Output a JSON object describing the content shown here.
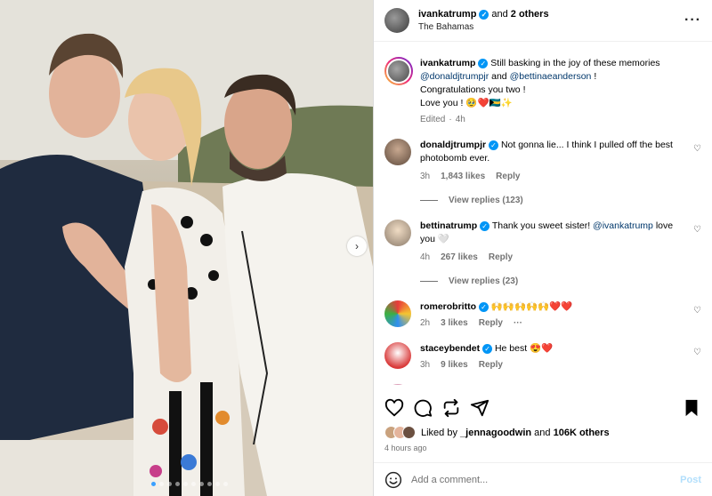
{
  "post": {
    "author": "ivankatrump",
    "collab_and": "and",
    "collab_others": "2 others",
    "location": "The Bahamas",
    "slide_count": 10,
    "active_slide": 1
  },
  "caption": {
    "username": "ivankatrump",
    "text1": "Still basking in the joy of these memories",
    "mention1": "@donaldjtrumpjr",
    "and": "and",
    "mention2": "@bettinaeanderson",
    "text2": "!",
    "line2": "Congratulations you two !",
    "line3": "Love you ! 🥹❤️🇧🇸✨",
    "edited": "Edited",
    "time": "4h"
  },
  "comments": [
    {
      "username": "donaldjtrumpjr",
      "verified": true,
      "text": "Not gonna lie... I think I pulled off the best photobomb ever.",
      "time": "3h",
      "likes": "1,843 likes",
      "reply": "Reply",
      "view_replies": "View replies (123)"
    },
    {
      "username": "bettinatrump",
      "verified": true,
      "text_pre": "Thank you sweet sister!",
      "mention": "@ivankatrump",
      "text_post": "love you 🤍",
      "time": "4h",
      "likes": "267 likes",
      "reply": "Reply",
      "view_replies": "View replies (23)"
    },
    {
      "username": "romerobritto",
      "verified": true,
      "text": "🙌🙌🙌🙌🙌❤️❤️",
      "time": "2h",
      "likes": "3 likes",
      "reply": "Reply",
      "more": "···"
    },
    {
      "username": "staceybendet",
      "verified": true,
      "text": "He best 😍❤️",
      "time": "3h",
      "likes": "9 likes",
      "reply": "Reply"
    }
  ],
  "likes": {
    "liked_by": "Liked by",
    "user": "_jennagoodwin",
    "and": "and",
    "others": "106K others"
  },
  "timestamp": "4 hours ago",
  "add_comment": {
    "placeholder": "Add a comment...",
    "post": "Post"
  },
  "icons": {
    "like": "heart-icon",
    "comment": "comment-icon",
    "share": "share-icon",
    "repost": "repost-icon",
    "save": "bookmark-icon",
    "more": "more-icon",
    "next": "chevron-right-icon",
    "emoji": "emoji-icon"
  },
  "colors": {
    "verified": "#0095f6",
    "mention": "#00376b",
    "muted": "#737373",
    "post_disabled": "#b2dffc",
    "carousel_active_dot": "#3aa0ff"
  }
}
